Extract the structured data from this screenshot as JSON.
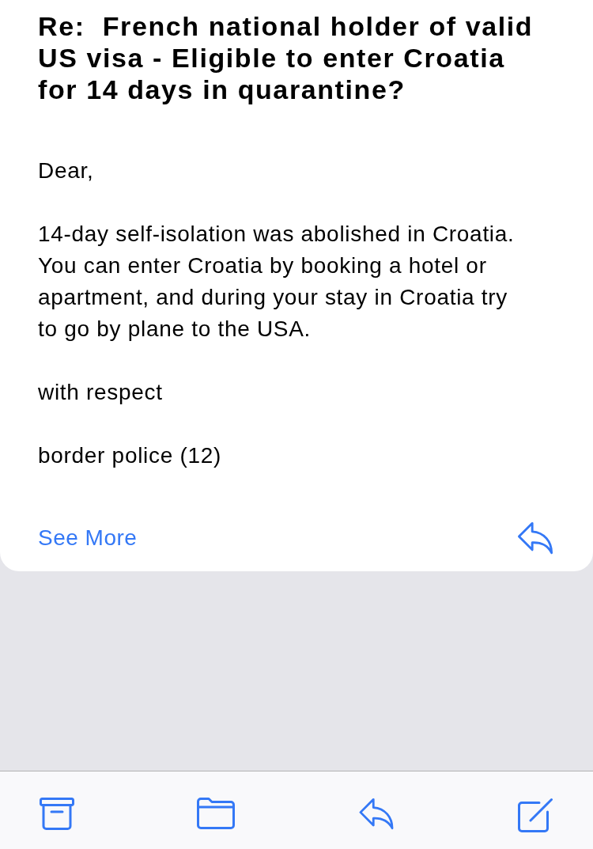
{
  "message": {
    "subject": "Re:  French national holder of valid US visa - Eligible to enter Croatia for 14 days in quarantine?",
    "body": [
      "Dear,",
      "14-day self-isolation was abolished in Croatia. You can enter Croatia by booking a hotel or apartment, and during your stay in Croatia try to go by plane to the USA.",
      "with respect",
      "border police (12)"
    ],
    "see_more": "See More"
  }
}
